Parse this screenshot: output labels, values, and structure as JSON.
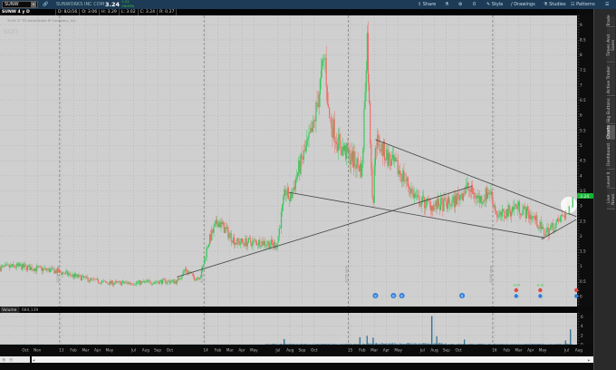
{
  "header": {
    "symbol": "SUNW",
    "company": "SUNWORKS INC COM",
    "last": "3.24",
    "change": "+.21",
    "change_pct": "+6.93%",
    "buttons": {
      "share": "Share",
      "zero": "0",
      "style": "Style",
      "drawings": "Drawings",
      "studies": "Studies",
      "patterns": "Patterns"
    }
  },
  "infobar": {
    "title": "SUNW 4 y D [NASDAQ]",
    "date": "D: 8/2/16",
    "open": "O: 3.06",
    "high": "H: 3.29",
    "low": "L: 3.02",
    "close": "C: 3.24",
    "range": "R: 0.27"
  },
  "chart": {
    "copyright": "2016 © TD Ameritrade IP Company, Inc.",
    "watermark": "sun",
    "price_badge": "3.24",
    "accent_up": "#35c95a",
    "accent_down": "#ef6e66"
  },
  "volume": {
    "label": "Volume",
    "value": "684,139",
    "ticks": [
      "6",
      "4",
      "2",
      "0"
    ],
    "max_millions": 6.5
  },
  "sidebar": {
    "tabs": [
      "Trade",
      "Times And Sales",
      "Active Trader",
      "Big Buttons",
      "Charts",
      "Dashboard",
      "Level II",
      "Live News"
    ],
    "active": "Charts"
  },
  "chart_data": {
    "type": "candlestick",
    "y_ticks": [
      "0",
      "0.5",
      "1",
      "1.5",
      "2",
      "2.5",
      "3",
      "3.5",
      "4",
      "4.5",
      "5",
      "5.5",
      "6",
      "6.5",
      "7",
      "7.5",
      "8",
      "8.5",
      "9"
    ],
    "ylim": [
      0,
      9
    ],
    "x_labels": [
      {
        "t": "Oct",
        "m": 0
      },
      {
        "t": "Nov",
        "m": 1
      },
      {
        "t": "13",
        "m": 3
      },
      {
        "t": "Feb",
        "m": 4
      },
      {
        "t": "Mar",
        "m": 5
      },
      {
        "t": "Apr",
        "m": 6
      },
      {
        "t": "May",
        "m": 7
      },
      {
        "t": "Jul",
        "m": 9
      },
      {
        "t": "Aug",
        "m": 10
      },
      {
        "t": "Sep",
        "m": 11
      },
      {
        "t": "Oct",
        "m": 12
      },
      {
        "t": "14",
        "m": 15
      },
      {
        "t": "Feb",
        "m": 16
      },
      {
        "t": "Mar",
        "m": 17
      },
      {
        "t": "Apr",
        "m": 18
      },
      {
        "t": "May",
        "m": 19
      },
      {
        "t": "Jul",
        "m": 21
      },
      {
        "t": "Aug",
        "m": 22
      },
      {
        "t": "Sep",
        "m": 23
      },
      {
        "t": "Oct",
        "m": 24
      },
      {
        "t": "15",
        "m": 27
      },
      {
        "t": "Feb",
        "m": 28
      },
      {
        "t": "Mar",
        "m": 29
      },
      {
        "t": "Apr",
        "m": 30
      },
      {
        "t": "May",
        "m": 31
      },
      {
        "t": "Jul",
        "m": 33
      },
      {
        "t": "Aug",
        "m": 34
      },
      {
        "t": "Sep",
        "m": 35
      },
      {
        "t": "Oct",
        "m": 36
      },
      {
        "t": "16",
        "m": 39
      },
      {
        "t": "Feb",
        "m": 40
      },
      {
        "t": "Mar",
        "m": 41
      },
      {
        "t": "Apr",
        "m": 42
      },
      {
        "t": "May",
        "m": 43
      },
      {
        "t": "Jul",
        "m": 45
      },
      {
        "t": "Aug",
        "m": 46
      }
    ],
    "year_markers": [
      {
        "t": "2013 year",
        "m": 3
      },
      {
        "t": "2014 year",
        "m": 15
      },
      {
        "t": "2015 year",
        "m": 27
      },
      {
        "t": "2016 year",
        "m": 39
      }
    ],
    "price_path": [
      [
        -2.1,
        0.95
      ],
      [
        -0.6,
        1.0
      ],
      [
        2.4,
        0.85
      ],
      [
        5.4,
        0.55
      ],
      [
        6.9,
        0.45
      ],
      [
        9.2,
        0.45
      ],
      [
        11.4,
        0.5
      ],
      [
        12.6,
        0.5
      ],
      [
        13.3,
        0.9
      ],
      [
        14.1,
        0.6
      ],
      [
        14.6,
        0.7
      ],
      [
        15.2,
        1.8
      ],
      [
        16,
        2.5
      ],
      [
        17.5,
        1.8
      ],
      [
        19.7,
        1.8
      ],
      [
        20.9,
        1.7
      ],
      [
        21.6,
        3.5
      ],
      [
        22,
        3.2
      ],
      [
        22.7,
        4.2
      ],
      [
        23.9,
        5.5
      ],
      [
        24.9,
        8.0
      ],
      [
        25.2,
        6.0
      ],
      [
        26.1,
        5.0
      ],
      [
        27.3,
        4.5
      ],
      [
        28,
        4.2
      ],
      [
        28.4,
        8.8
      ],
      [
        28.6,
        6.0
      ],
      [
        28.9,
        2.9
      ],
      [
        29.1,
        5.2
      ],
      [
        30.3,
        4.5
      ],
      [
        31.4,
        4.0
      ],
      [
        32.5,
        3.2
      ],
      [
        34,
        3.0
      ],
      [
        35.5,
        3.1
      ],
      [
        36.7,
        3.6
      ],
      [
        37.8,
        3.2
      ],
      [
        38.6,
        3.5
      ],
      [
        39.3,
        2.6
      ],
      [
        40.8,
        3.0
      ],
      [
        42.3,
        2.6
      ],
      [
        43.1,
        2.1
      ],
      [
        44.2,
        2.4
      ],
      [
        44.9,
        2.8
      ],
      [
        45.5,
        3.24
      ]
    ],
    "trend_lines": [
      [
        [
          12.6,
          0.65
        ],
        [
          37.1,
          3.65
        ]
      ],
      [
        [
          21.9,
          3.45
        ],
        [
          43.1,
          1.95
        ]
      ],
      [
        [
          29.1,
          5.2
        ],
        [
          45.8,
          2.65
        ]
      ],
      [
        [
          42.9,
          1.9
        ],
        [
          45.8,
          2.55
        ]
      ]
    ],
    "volume_spikes_millions": [
      [
        21.5,
        1.2
      ],
      [
        27.8,
        1.6
      ],
      [
        28.4,
        1.9
      ],
      [
        28.9,
        1.5
      ],
      [
        33.8,
        6.2
      ],
      [
        34.2,
        1.8
      ],
      [
        36.5,
        1.1
      ],
      [
        44.9,
        0.9
      ],
      [
        45.3,
        3.3
      ]
    ],
    "earnings": {
      "past": [
        29.1,
        30.6,
        31.3,
        36.3
      ],
      "upcoming": [
        {
          "m": 40.8,
          "label": "-0.04"
        },
        {
          "m": 42.8,
          "label": "-0.02"
        },
        {
          "m": 45.8,
          "label": ""
        }
      ]
    }
  }
}
